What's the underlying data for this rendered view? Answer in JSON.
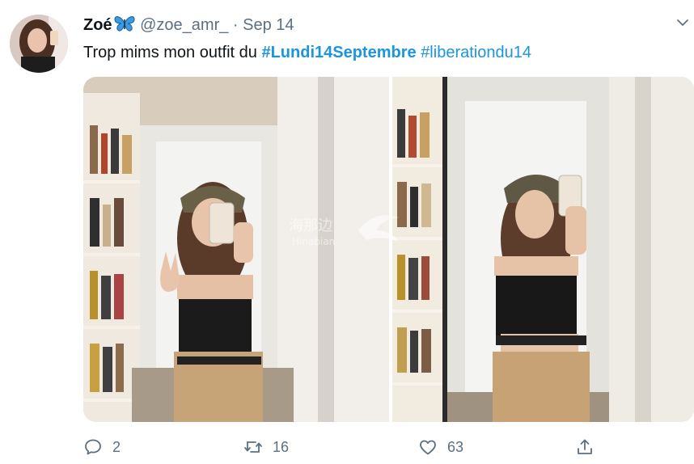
{
  "tweet": {
    "display_name": "Zoé",
    "name_emoji": "blue-butterfly-emoji",
    "handle": "@zoe_amr_",
    "separator": " · ",
    "date": "Sep 14",
    "text_prefix": "Trop mims mon outfit du ",
    "hashtag_1": "#Lundi14Septembre",
    "hashtag_2": "#liberationdu14"
  },
  "media": {
    "watermark_cn": "海那边",
    "watermark_en": "Hinabian"
  },
  "actions": {
    "reply_icon": "reply-icon",
    "reply_count": "2",
    "retweet_icon": "retweet-icon",
    "retweet_count": "16",
    "like_icon": "heart-icon",
    "like_count": "63",
    "share_icon": "share-icon"
  },
  "colors": {
    "hashtag": "#1b95e0",
    "muted": "#5b7083",
    "text": "#0f1419"
  }
}
